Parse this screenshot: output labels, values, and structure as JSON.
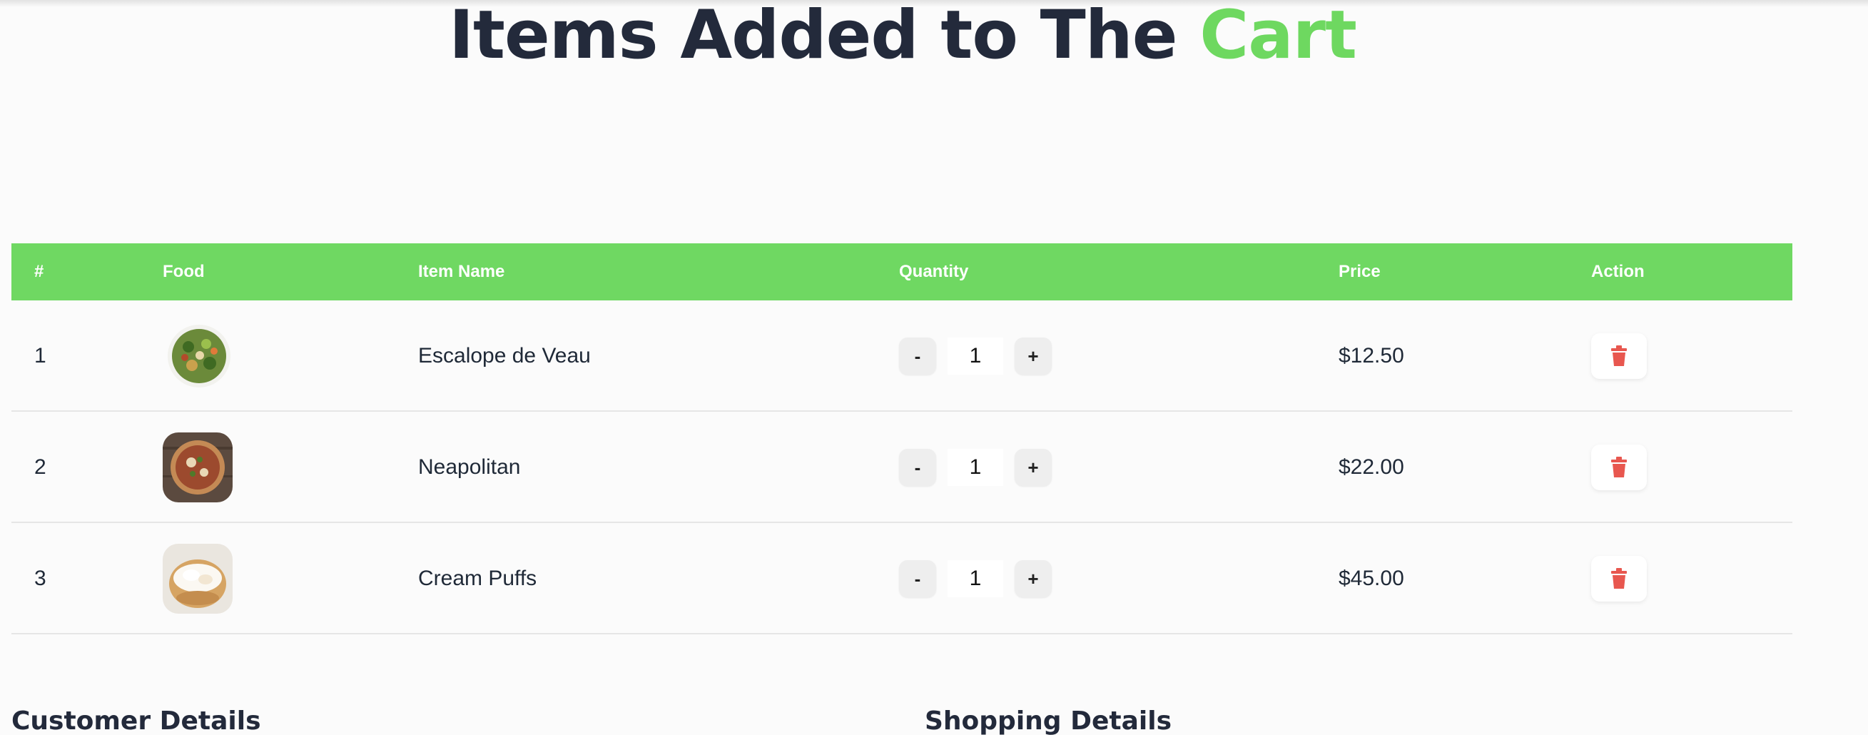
{
  "header": {
    "title_main": "Items Added to The",
    "title_accent": "Cart",
    "accent_color": "#6ed860"
  },
  "table": {
    "columns": [
      "#",
      "Food",
      "Item Name",
      "Quantity",
      "Price",
      "Action"
    ],
    "header_color": "#6fd862",
    "rows": [
      {
        "num": "1",
        "image": "salad-image",
        "name": "Escalope de Veau",
        "qty": "1",
        "price": "$12.50",
        "decrement": "-",
        "increment": "+",
        "action_icon": "trash-icon"
      },
      {
        "num": "2",
        "image": "pizza-image",
        "name": "Neapolitan",
        "qty": "1",
        "price": "$22.00",
        "decrement": "-",
        "increment": "+",
        "action_icon": "trash-icon"
      },
      {
        "num": "3",
        "image": "cream-puff-image",
        "name": "Cream Puffs",
        "qty": "1",
        "price": "$45.00",
        "decrement": "-",
        "increment": "+",
        "action_icon": "trash-icon"
      }
    ]
  },
  "sections": {
    "customer": "Customer Details",
    "shopping": "Shopping Details"
  },
  "colors": {
    "delete_icon": "#e8574f"
  }
}
